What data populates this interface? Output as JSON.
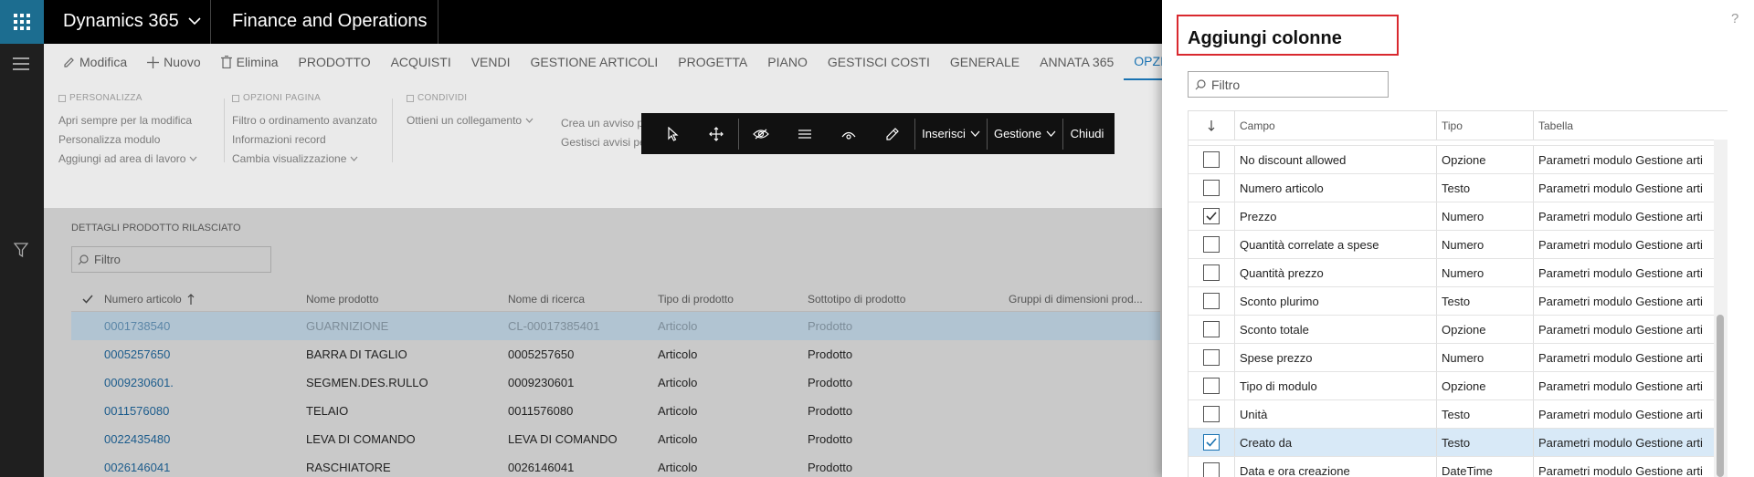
{
  "topbar": {
    "app_name": "Dynamics 365",
    "module_name": "Finance and Operations"
  },
  "actionbar": {
    "items": [
      {
        "label": "Modifica",
        "icon": "pencil-icon"
      },
      {
        "label": "Nuovo",
        "icon": "plus-icon"
      },
      {
        "label": "Elimina",
        "icon": "trash-icon"
      },
      {
        "label": "PRODOTTO"
      },
      {
        "label": "ACQUISTI"
      },
      {
        "label": "VENDI"
      },
      {
        "label": "GESTIONE ARTICOLI"
      },
      {
        "label": "PROGETTA"
      },
      {
        "label": "PIANO"
      },
      {
        "label": "GESTISCI COSTI"
      },
      {
        "label": "GENERALE"
      },
      {
        "label": "ANNATA 365"
      },
      {
        "label": "OPZIONI",
        "active": true
      }
    ]
  },
  "ribbon_groups": {
    "personalizza": {
      "header": "PERSONALIZZA",
      "items": [
        "Apri sempre per la modifica",
        "Personalizza modulo",
        "Aggiungi ad area di lavoro"
      ]
    },
    "opzioni_pagina": {
      "header": "OPZIONI PAGINA",
      "items": [
        "Filtro o ordinamento avanzato",
        "Informazioni record",
        "Cambia visualizzazione"
      ]
    },
    "condividi": {
      "header": "CONDIVIDI",
      "items": [
        "Ottieni un collegamento"
      ]
    },
    "avvisi": {
      "items": [
        "Crea un avviso p",
        "Gestisci avvisi pe"
      ]
    }
  },
  "floating_toolbar": {
    "icons": [
      "select-pointer-icon",
      "move-icon",
      "hide-eye-icon",
      "summary-lines-icon",
      "rename-icon",
      "edit-pencil-icon"
    ],
    "inserisci": "Inserisci",
    "gestione": "Gestione",
    "chiudi": "Chiudi"
  },
  "grid": {
    "section_title": "DETTAGLI PRODOTTO RILASCIATO",
    "filter_placeholder": "Filtro",
    "columns": [
      "Numero articolo",
      "Nome prodotto",
      "Nome di ricerca",
      "Tipo di prodotto",
      "Sottotipo di prodotto",
      "Gruppi di dimensioni prod..."
    ],
    "rows": [
      [
        "0001738540",
        "GUARNIZIONE",
        "CL-00017385401",
        "Articolo",
        "Prodotto"
      ],
      [
        "0005257650",
        "BARRA DI TAGLIO",
        "0005257650",
        "Articolo",
        "Prodotto"
      ],
      [
        "0009230601.",
        "SEGMEN.DES.RULLO",
        "0009230601",
        "Articolo",
        "Prodotto"
      ],
      [
        "0011576080",
        "TELAIO",
        "0011576080",
        "Articolo",
        "Prodotto"
      ],
      [
        "0022435480",
        "LEVA DI COMANDO",
        "LEVA DI COMANDO",
        "Articolo",
        "Prodotto"
      ],
      [
        "0026146041",
        "RASCHIATORE",
        "0026146041",
        "Articolo",
        "Prodotto"
      ]
    ]
  },
  "panel": {
    "title": "Aggiungi colonne",
    "help": "?",
    "filter_placeholder": "Filtro",
    "columns": {
      "campo": "Campo",
      "tipo": "Tipo",
      "tabella": "Tabella"
    },
    "rows": [
      {
        "campo": "No discount allowed",
        "tipo": "Opzione",
        "tabella": "Parametri modulo Gestione arti",
        "checked": false
      },
      {
        "campo": "Numero articolo",
        "tipo": "Testo",
        "tabella": "Parametri modulo Gestione arti",
        "checked": false
      },
      {
        "campo": "Prezzo",
        "tipo": "Numero",
        "tabella": "Parametri modulo Gestione arti",
        "checked": true
      },
      {
        "campo": "Quantità correlate a spese",
        "tipo": "Numero",
        "tabella": "Parametri modulo Gestione arti",
        "checked": false
      },
      {
        "campo": "Quantità prezzo",
        "tipo": "Numero",
        "tabella": "Parametri modulo Gestione arti",
        "checked": false
      },
      {
        "campo": "Sconto plurimo",
        "tipo": "Testo",
        "tabella": "Parametri modulo Gestione arti",
        "checked": false
      },
      {
        "campo": "Sconto totale",
        "tipo": "Opzione",
        "tabella": "Parametri modulo Gestione arti",
        "checked": false
      },
      {
        "campo": "Spese prezzo",
        "tipo": "Numero",
        "tabella": "Parametri modulo Gestione arti",
        "checked": false
      },
      {
        "campo": "Tipo di modulo",
        "tipo": "Opzione",
        "tabella": "Parametri modulo Gestione arti",
        "checked": false
      },
      {
        "campo": "Unità",
        "tipo": "Testo",
        "tabella": "Parametri modulo Gestione arti",
        "checked": false
      },
      {
        "campo": "Creato da",
        "tipo": "Testo",
        "tabella": "Parametri modulo Gestione arti",
        "checked": true,
        "highlighted": true
      },
      {
        "campo": "Data e ora creazione",
        "tipo": "DateTime",
        "tabella": "Parametri modulo Gestione arti",
        "checked": false
      }
    ]
  },
  "colors": {
    "accent": "#1a73b2",
    "waffle": "#1c6d90",
    "title_box_border": "#d9292f"
  }
}
